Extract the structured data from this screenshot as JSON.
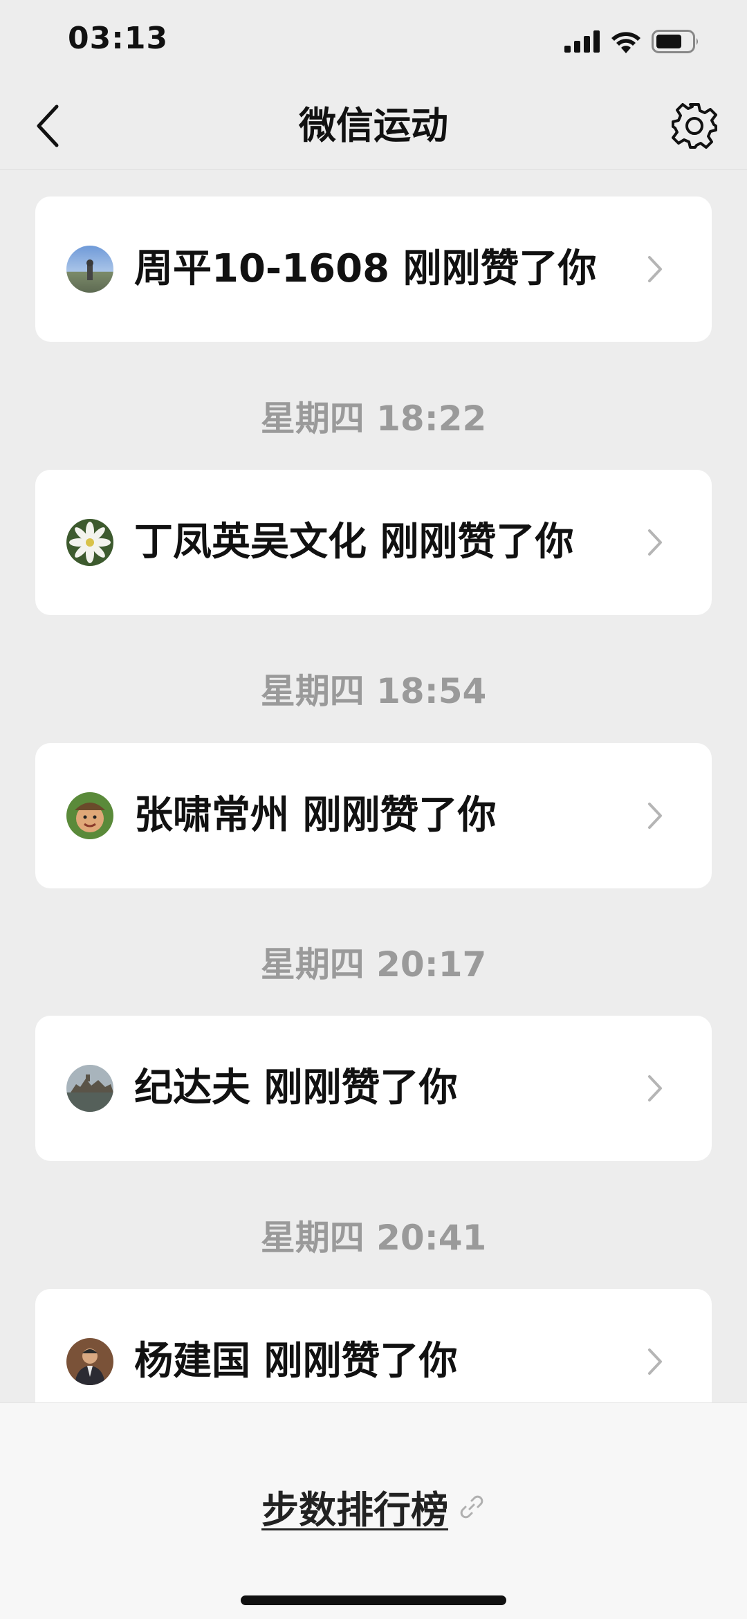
{
  "status_bar": {
    "time": "03:13"
  },
  "nav": {
    "title": "微信运动",
    "back_icon": "chevron-left-icon",
    "settings_icon": "gear-icon"
  },
  "items": [
    {
      "text": "周平10-1608 刚刚赞了你"
    },
    {
      "timestamp": "星期四 18:22",
      "text": "丁凤英吴文化 刚刚赞了你"
    },
    {
      "timestamp": "星期四 18:54",
      "text": "张啸常州 刚刚赞了你"
    },
    {
      "timestamp": "星期四 20:17",
      "text": "纪达夫 刚刚赞了你"
    },
    {
      "timestamp": "星期四 20:41",
      "text": "杨建国 刚刚赞了你"
    }
  ],
  "bottom_bar": {
    "ranking_label": "步数排行榜",
    "link_icon": "link-icon"
  },
  "colors": {
    "background": "#ededed",
    "card": "#ffffff",
    "timestamp_text": "#9a9a9a"
  }
}
